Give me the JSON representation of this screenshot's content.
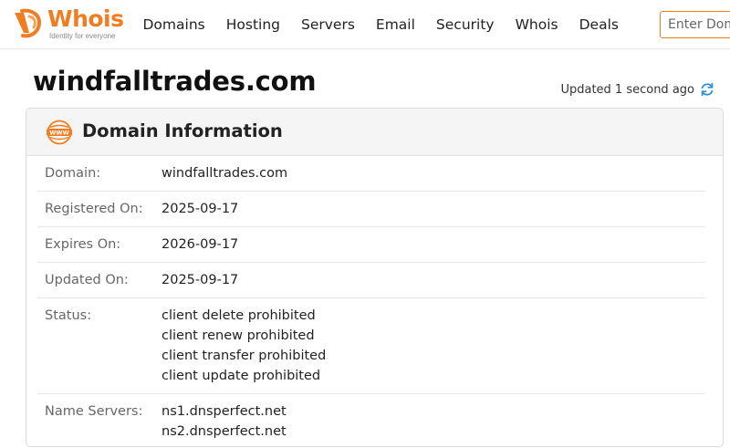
{
  "brand": {
    "name": "Whois",
    "tagline": "Identity for everyone",
    "accent": "#f07d22"
  },
  "nav": {
    "items": [
      "Domains",
      "Hosting",
      "Servers",
      "Email",
      "Security",
      "Whois",
      "Deals"
    ]
  },
  "search": {
    "placeholder": "Enter Domain"
  },
  "page": {
    "title": "windfalltrades.com",
    "updated_text": "Updated 1 second ago",
    "refresh_icon": "refresh-icon"
  },
  "card": {
    "title": "Domain Information",
    "icon": "www-icon",
    "rows": [
      {
        "label": "Domain:",
        "values": [
          "windfalltrades.com"
        ]
      },
      {
        "label": "Registered On:",
        "values": [
          "2025-09-17"
        ]
      },
      {
        "label": "Expires On:",
        "values": [
          "2026-09-17"
        ]
      },
      {
        "label": "Updated On:",
        "values": [
          "2025-09-17"
        ]
      },
      {
        "label": "Status:",
        "values": [
          "client delete prohibited",
          "client renew prohibited",
          "client transfer prohibited",
          "client update prohibited"
        ]
      },
      {
        "label": "Name Servers:",
        "values": [
          "ns1.dnsperfect.net",
          "ns2.dnsperfect.net"
        ]
      }
    ]
  }
}
